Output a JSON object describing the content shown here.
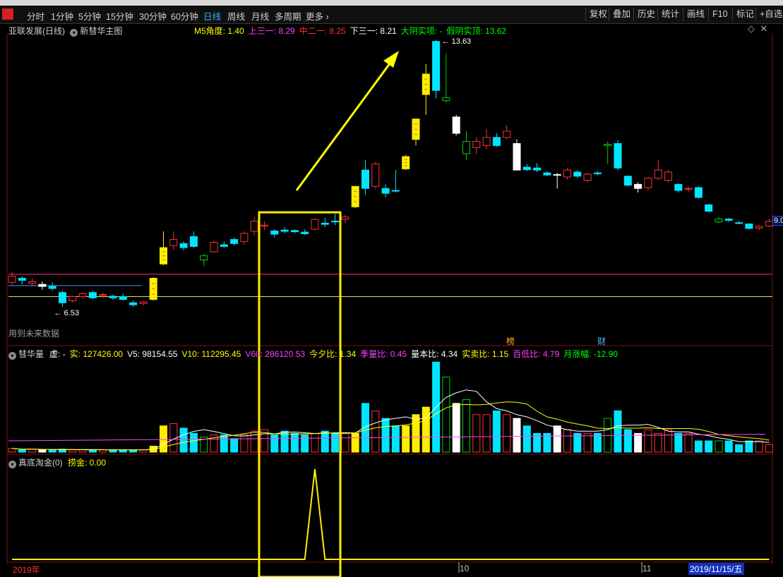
{
  "toolbar": {
    "periods": [
      "分时",
      "1分钟",
      "5分钟",
      "15分钟",
      "30分钟",
      "60分钟",
      "日线",
      "周线",
      "月线",
      "多周期",
      "更多"
    ],
    "active_period": "日线",
    "right_buttons": [
      "复权",
      "叠加",
      "历史",
      "统计",
      "画线",
      "F10",
      "标记",
      "+自选"
    ]
  },
  "main_panel": {
    "stock_title": "亚联发展(日线)",
    "indicator_name": "新彗华主图",
    "legend": [
      {
        "label": "M5角度:",
        "value": "1.40",
        "color": "#ffff00"
      },
      {
        "label": "上三一:",
        "value": "8.29",
        "color": "#ff40ff"
      },
      {
        "label": "中二一:",
        "value": "8.25",
        "color": "#ff3030"
      },
      {
        "label": "下三一:",
        "value": "8.21",
        "color": "#ffffff"
      },
      {
        "label": "大阴实项:",
        "value": "-",
        "color": "#00ff00"
      },
      {
        "label": "假阴实顶:",
        "value": "13.62",
        "color": "#00ff00"
      }
    ],
    "high_label": "13.63",
    "low_label": "6.53",
    "future_note": "用到未来数据",
    "right_axis_value": "9.0",
    "badges": [
      "榜",
      "财"
    ]
  },
  "volume_panel": {
    "title": "彗华量",
    "legend": [
      {
        "label": "虚:",
        "value": "-",
        "color": "#ffffff"
      },
      {
        "label": "实:",
        "value": "127426.00",
        "color": "#ffff00"
      },
      {
        "label": "V5:",
        "value": "98154.55",
        "color": "#ffffff"
      },
      {
        "label": "V10:",
        "value": "112295.45",
        "color": "#ffff00"
      },
      {
        "label": "V60:",
        "value": "286120.53",
        "color": "#ff40ff"
      },
      {
        "label": "今夕比:",
        "value": "1.34",
        "color": "#ffff00"
      },
      {
        "label": "季量比:",
        "value": "0.45",
        "color": "#ff40ff"
      },
      {
        "label": "量本比:",
        "value": "4.34",
        "color": "#ffffff"
      },
      {
        "label": "实卖比:",
        "value": "1.15",
        "color": "#ffff00"
      },
      {
        "label": "百低比:",
        "value": "4.79",
        "color": "#ff40ff"
      },
      {
        "label": "月涨幅:",
        "value": "-12.90",
        "color": "#00ff00"
      }
    ]
  },
  "signal_panel": {
    "title": "真底淘金(0)",
    "legend": [
      {
        "label": "捞金:",
        "value": "0.00",
        "color": "#ffff00"
      }
    ]
  },
  "date_axis": {
    "start": "2019年",
    "labels": [
      "10",
      "11"
    ],
    "cursor_date": "2019/11/15/五"
  },
  "chart_data": [
    {
      "type": "candlestick",
      "title": "亚联发展(日线)",
      "annotations": [
        "13.63",
        "6.53"
      ],
      "candles": [
        {
          "o": 7.85,
          "h": 7.95,
          "l": 7.65,
          "c": 7.7,
          "col": "red"
        },
        {
          "o": 7.8,
          "h": 7.85,
          "l": 7.65,
          "c": 7.75,
          "col": "cyan"
        },
        {
          "o": 7.72,
          "h": 7.8,
          "l": 7.6,
          "c": 7.68,
          "col": "red"
        },
        {
          "o": 7.65,
          "h": 7.72,
          "l": 7.52,
          "c": 7.6,
          "col": "white"
        },
        {
          "o": 7.6,
          "h": 7.7,
          "l": 7.5,
          "c": 7.55,
          "col": "cyan"
        },
        {
          "o": 7.45,
          "h": 7.5,
          "l": 7.1,
          "c": 7.2,
          "col": "cyan"
        },
        {
          "o": 7.25,
          "h": 7.38,
          "l": 7.2,
          "c": 7.35,
          "col": "red"
        },
        {
          "o": 7.35,
          "h": 7.45,
          "l": 7.3,
          "c": 7.42,
          "col": "red"
        },
        {
          "o": 7.45,
          "h": 7.5,
          "l": 7.28,
          "c": 7.32,
          "col": "cyan"
        },
        {
          "o": 7.38,
          "h": 7.45,
          "l": 7.32,
          "c": 7.4,
          "col": "red"
        },
        {
          "o": 7.36,
          "h": 7.4,
          "l": 7.27,
          "c": 7.32,
          "col": "cyan"
        },
        {
          "o": 7.35,
          "h": 7.42,
          "l": 7.25,
          "c": 7.28,
          "col": "cyan"
        },
        {
          "o": 7.2,
          "h": 7.25,
          "l": 7.1,
          "c": 7.15,
          "col": "cyan"
        },
        {
          "o": 7.18,
          "h": 7.25,
          "l": 7.13,
          "c": 7.22,
          "col": "red"
        },
        {
          "o": 7.28,
          "h": 7.82,
          "l": 7.25,
          "c": 7.8,
          "col": "yellow"
        },
        {
          "o": 8.55,
          "h": 8.95,
          "l": 8.12,
          "c": 8.15,
          "col": "yellow"
        },
        {
          "o": 8.6,
          "h": 8.95,
          "l": 8.5,
          "c": 8.75,
          "col": "red"
        },
        {
          "o": 8.65,
          "h": 8.7,
          "l": 8.48,
          "c": 8.55,
          "col": "cyan"
        },
        {
          "o": 8.82,
          "h": 8.95,
          "l": 8.55,
          "c": 8.58,
          "col": "cyan"
        },
        {
          "o": 8.25,
          "h": 8.4,
          "l": 8.1,
          "c": 8.35,
          "col": "green"
        },
        {
          "o": 8.45,
          "h": 8.72,
          "l": 8.42,
          "c": 8.68,
          "col": "red"
        },
        {
          "o": 8.62,
          "h": 8.7,
          "l": 8.55,
          "c": 8.58,
          "col": "cyan"
        },
        {
          "o": 8.65,
          "h": 8.8,
          "l": 8.6,
          "c": 8.75,
          "col": "cyan"
        },
        {
          "o": 8.7,
          "h": 8.95,
          "l": 8.62,
          "c": 8.9,
          "col": "red"
        },
        {
          "o": 8.95,
          "h": 9.3,
          "l": 8.85,
          "c": 9.2,
          "col": "red"
        },
        {
          "o": 9.08,
          "h": 9.2,
          "l": 8.98,
          "c": 9.1,
          "col": "red"
        },
        {
          "o": 8.88,
          "h": 9.0,
          "l": 8.8,
          "c": 8.96,
          "col": "cyan"
        },
        {
          "o": 8.98,
          "h": 9.05,
          "l": 8.9,
          "c": 8.95,
          "col": "cyan"
        },
        {
          "o": 8.94,
          "h": 9.0,
          "l": 8.9,
          "c": 8.97,
          "col": "cyan"
        },
        {
          "o": 8.93,
          "h": 9.0,
          "l": 8.86,
          "c": 8.89,
          "col": "cyan"
        },
        {
          "o": 9.0,
          "h": 9.27,
          "l": 8.98,
          "c": 9.24,
          "col": "red"
        },
        {
          "o": 9.12,
          "h": 9.28,
          "l": 9.05,
          "c": 9.15,
          "col": "cyan"
        },
        {
          "o": 9.18,
          "h": 9.38,
          "l": 9.1,
          "c": 9.2,
          "col": "cyan"
        },
        {
          "o": 9.25,
          "h": 9.35,
          "l": 9.15,
          "c": 9.3,
          "col": "red"
        },
        {
          "o": 9.55,
          "h": 10.05,
          "l": 9.52,
          "c": 10.05,
          "col": "yellow"
        },
        {
          "o": 10.45,
          "h": 10.7,
          "l": 9.85,
          "c": 10.0,
          "col": "cyan"
        },
        {
          "o": 10.05,
          "h": 10.65,
          "l": 10.0,
          "c": 10.6,
          "col": "red"
        },
        {
          "o": 10.0,
          "h": 10.1,
          "l": 9.78,
          "c": 9.88,
          "col": "cyan"
        },
        {
          "o": 9.95,
          "h": 10.45,
          "l": 9.9,
          "c": 9.95,
          "col": "cyan"
        },
        {
          "o": 10.48,
          "h": 10.82,
          "l": 10.45,
          "c": 10.78,
          "col": "yellow"
        },
        {
          "o": 11.2,
          "h": 11.7,
          "l": 11.05,
          "c": 11.7,
          "col": "yellow"
        },
        {
          "o": 12.3,
          "h": 13.05,
          "l": 11.8,
          "c": 12.8,
          "col": "yellow"
        },
        {
          "o": 13.6,
          "h": 13.63,
          "l": 12.2,
          "c": 12.4,
          "col": "cyan"
        },
        {
          "o": 12.15,
          "h": 13.3,
          "l": 12.1,
          "c": 12.22,
          "col": "green"
        },
        {
          "o": 11.75,
          "h": 11.8,
          "l": 11.3,
          "c": 11.35,
          "col": "white"
        },
        {
          "o": 10.85,
          "h": 11.4,
          "l": 10.7,
          "c": 11.15,
          "col": "green"
        },
        {
          "o": 11.0,
          "h": 11.25,
          "l": 10.85,
          "c": 11.15,
          "col": "red"
        },
        {
          "o": 11.05,
          "h": 11.45,
          "l": 10.95,
          "c": 11.25,
          "col": "red"
        },
        {
          "o": 11.25,
          "h": 11.35,
          "l": 11.02,
          "c": 11.05,
          "col": "cyan"
        },
        {
          "o": 11.25,
          "h": 11.55,
          "l": 11.2,
          "c": 11.4,
          "col": "red"
        },
        {
          "o": 11.1,
          "h": 11.2,
          "l": 10.45,
          "c": 10.45,
          "col": "white"
        },
        {
          "o": 10.52,
          "h": 10.6,
          "l": 10.42,
          "c": 10.46,
          "col": "cyan"
        },
        {
          "o": 10.5,
          "h": 10.62,
          "l": 10.4,
          "c": 10.45,
          "col": "cyan"
        },
        {
          "o": 10.38,
          "h": 10.42,
          "l": 10.3,
          "c": 10.33,
          "col": "cyan"
        },
        {
          "o": 10.33,
          "h": 10.38,
          "l": 10.0,
          "c": 10.34,
          "col": "white"
        },
        {
          "o": 10.28,
          "h": 10.5,
          "l": 10.22,
          "c": 10.45,
          "col": "red"
        },
        {
          "o": 10.4,
          "h": 10.45,
          "l": 10.25,
          "c": 10.3,
          "col": "cyan"
        },
        {
          "o": 10.2,
          "h": 10.38,
          "l": 10.15,
          "c": 10.35,
          "col": "red"
        },
        {
          "o": 10.38,
          "h": 10.42,
          "l": 10.32,
          "c": 10.36,
          "col": "cyan"
        },
        {
          "o": 11.08,
          "h": 11.15,
          "l": 10.6,
          "c": 11.05,
          "col": "green"
        },
        {
          "o": 11.1,
          "h": 11.18,
          "l": 10.45,
          "c": 10.5,
          "col": "cyan"
        },
        {
          "o": 10.3,
          "h": 10.32,
          "l": 10.05,
          "c": 10.08,
          "col": "cyan"
        },
        {
          "o": 10.1,
          "h": 10.15,
          "l": 9.9,
          "c": 10.0,
          "col": "white"
        },
        {
          "o": 10.02,
          "h": 10.28,
          "l": 9.95,
          "c": 10.25,
          "col": "red"
        },
        {
          "o": 10.25,
          "h": 10.7,
          "l": 10.2,
          "c": 10.45,
          "col": "red"
        },
        {
          "o": 10.4,
          "h": 10.45,
          "l": 10.15,
          "c": 10.2,
          "col": "red"
        },
        {
          "o": 10.1,
          "h": 10.12,
          "l": 9.9,
          "c": 9.95,
          "col": "cyan"
        },
        {
          "o": 9.98,
          "h": 10.05,
          "l": 9.92,
          "c": 10.0,
          "col": "red"
        },
        {
          "o": 10.02,
          "h": 10.05,
          "l": 9.75,
          "c": 9.78,
          "col": "cyan"
        },
        {
          "o": 9.6,
          "h": 9.62,
          "l": 9.42,
          "c": 9.44,
          "col": "cyan"
        },
        {
          "o": 9.25,
          "h": 9.3,
          "l": 9.15,
          "c": 9.18,
          "col": "green"
        },
        {
          "o": 9.25,
          "h": 9.28,
          "l": 9.18,
          "c": 9.22,
          "col": "cyan"
        },
        {
          "o": 9.15,
          "h": 9.2,
          "l": 9.12,
          "c": 9.16,
          "col": "cyan"
        },
        {
          "o": 9.13,
          "h": 9.15,
          "l": 9.0,
          "c": 9.02,
          "col": "cyan"
        },
        {
          "o": 9.03,
          "h": 9.1,
          "l": 8.98,
          "c": 9.07,
          "col": "red"
        },
        {
          "o": 9.08,
          "h": 9.25,
          "l": 9.05,
          "c": 9.2,
          "col": "red"
        }
      ]
    },
    {
      "type": "bar",
      "title": "彗华量",
      "values": [
        0.5,
        0.3,
        0.4,
        0.3,
        0.3,
        0.4,
        0.3,
        0.3,
        0.3,
        0.3,
        0.3,
        0.3,
        0.3,
        0.3,
        0.8,
        3.5,
        3.8,
        3.2,
        2.5,
        2.0,
        2.3,
        2.3,
        1.8,
        2.3,
        2.8,
        3.0,
        2.3,
        2.8,
        2.5,
        2.3,
        2.5,
        2.8,
        2.5,
        2.5,
        2.5,
        6.5,
        5.5,
        4.5,
        3.5,
        3.5,
        5.0,
        6.0,
        12.0,
        10.0,
        6.5,
        7.0,
        5.0,
        5.0,
        5.5,
        5.0,
        4.5,
        3.5,
        2.5,
        2.5,
        3.5,
        3.0,
        2.5,
        2.5,
        2.5,
        4.5,
        5.5,
        3.0,
        2.5,
        3.0,
        2.5,
        3.0,
        2.5,
        2.5,
        1.5,
        1.5,
        1.5,
        1.5,
        1.0,
        1.5,
        1.5,
        1.0
      ]
    },
    {
      "type": "line",
      "title": "真底淘金(0)",
      "values": [
        0,
        0,
        0,
        0,
        0,
        0,
        0,
        0,
        0,
        0,
        0,
        0,
        0,
        0,
        0,
        0,
        0,
        0,
        0,
        0,
        0,
        0,
        0,
        0,
        0,
        0,
        0,
        0,
        0,
        0,
        1,
        0,
        0,
        0,
        0,
        0,
        0,
        0,
        0,
        0,
        0,
        0,
        0,
        0,
        0,
        0,
        0,
        0,
        0,
        0,
        0,
        0,
        0,
        0,
        0,
        0,
        0,
        0,
        0,
        0,
        0,
        0,
        0,
        0,
        0,
        0,
        0,
        0,
        0,
        0,
        0,
        0,
        0,
        0,
        0,
        0
      ]
    }
  ]
}
